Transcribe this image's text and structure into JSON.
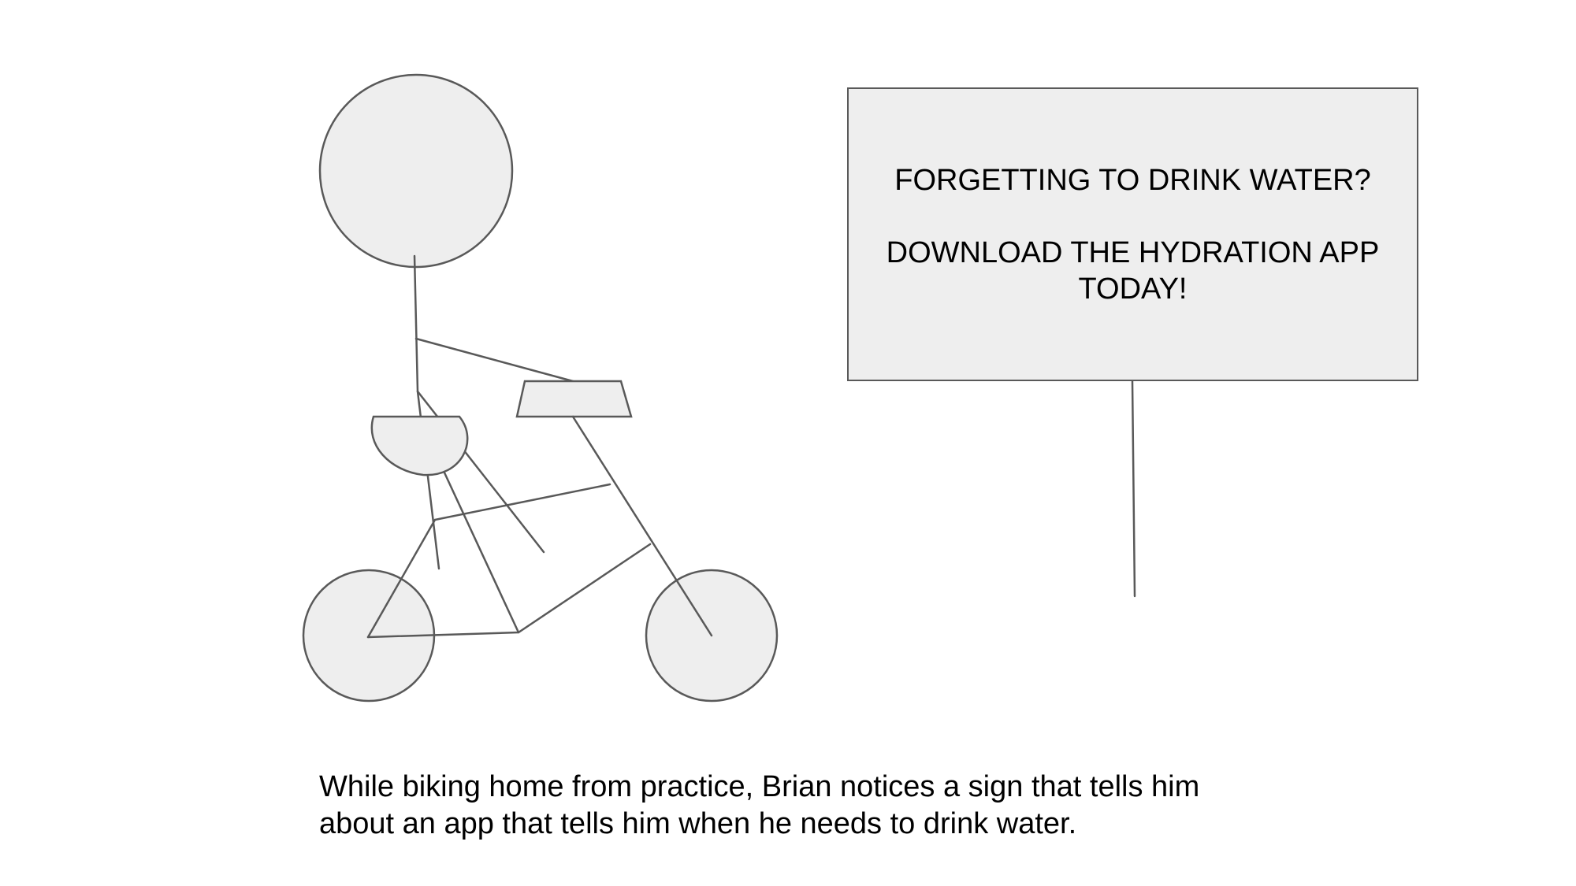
{
  "sign": {
    "line1": "FORGETTING TO DRINK WATER?",
    "line2": "DOWNLOAD THE HYDRATION APP TODAY!"
  },
  "caption": {
    "line1": "While biking home from practice, Brian notices a sign that tells him",
    "line2": "about an app that tells him when he needs to drink water."
  },
  "colors": {
    "stroke": "#595959",
    "fill": "#eeeeee",
    "text": "#000000",
    "background": "#ffffff"
  }
}
